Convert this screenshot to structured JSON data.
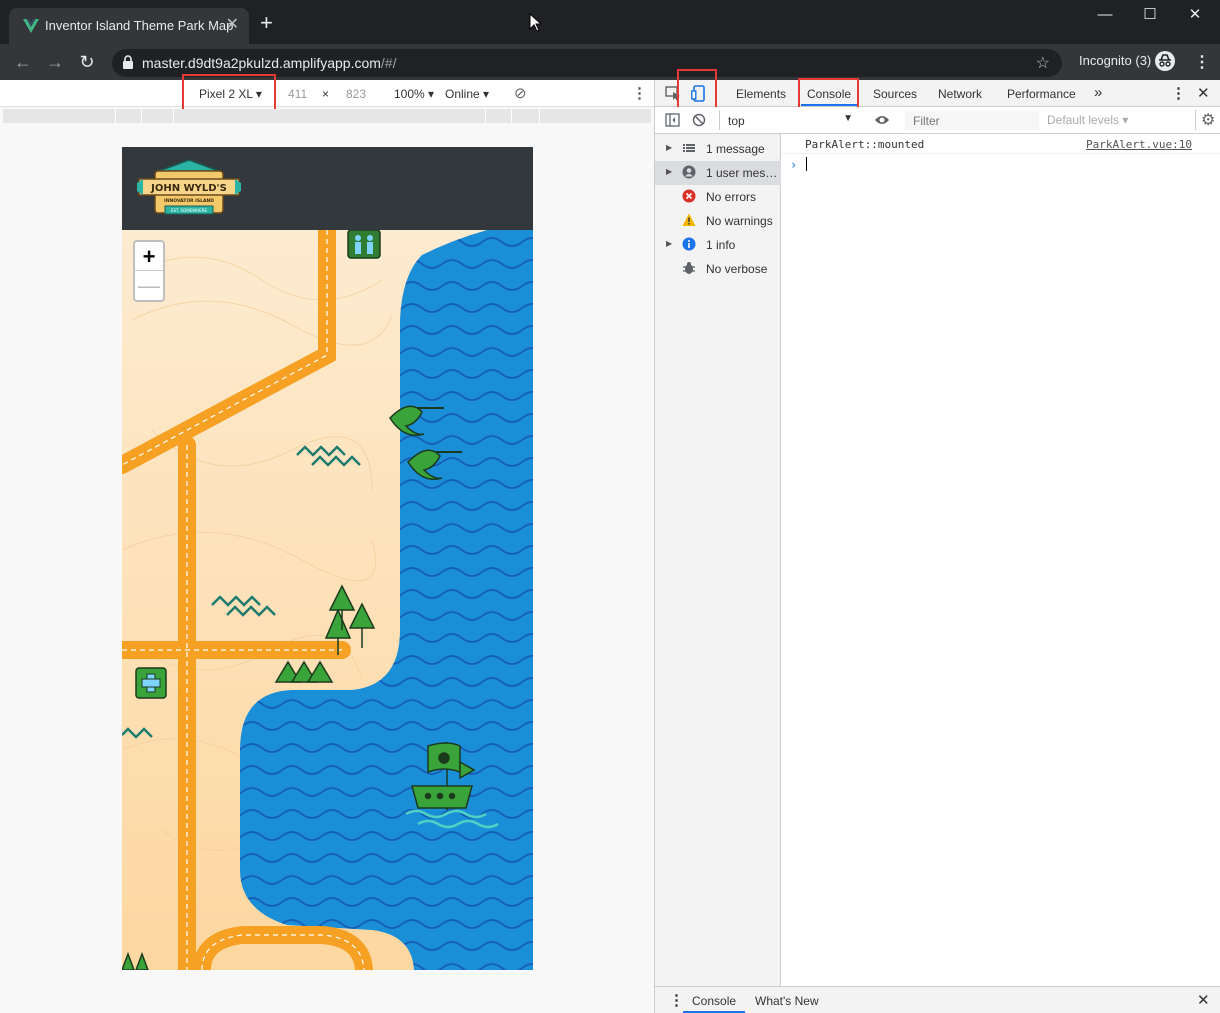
{
  "browser": {
    "tab": {
      "title": "Inventor Island Theme Park Map"
    },
    "url": {
      "host": "master.d9dt9a2pkulzd.amplifyapp.com",
      "path": "/#/"
    },
    "incognito_label": "Incognito (3)"
  },
  "device_toolbar": {
    "device": "Pixel 2 XL",
    "width": "411",
    "times": "×",
    "height": "823",
    "zoom": "100%",
    "network": "Online"
  },
  "map": {
    "zoom_in": "+",
    "zoom_out": "—",
    "logo": {
      "line1": "JOHN WYLD'S",
      "line2": "INNOVATOR ISLAND",
      "line3": "EST. SOMEWHERE"
    }
  },
  "devtools": {
    "tabs": [
      "Elements",
      "Console",
      "Sources",
      "Network",
      "Performance"
    ],
    "more_tabs": "»",
    "context": "top",
    "filter_placeholder": "Filter",
    "levels": "Default levels",
    "sidebar": [
      {
        "label": "1 message",
        "icon": "list-icon",
        "expandable": true
      },
      {
        "label": "1 user mess…",
        "icon": "user-icon",
        "expandable": true
      },
      {
        "label": "No errors",
        "icon": "error-icon",
        "expandable": false
      },
      {
        "label": "No warnings",
        "icon": "warning-icon",
        "expandable": false
      },
      {
        "label": "1 info",
        "icon": "info-icon",
        "expandable": true
      },
      {
        "label": "No verbose",
        "icon": "bug-icon",
        "expandable": false
      }
    ],
    "console": {
      "message": "ParkAlert::mounted",
      "source": "ParkAlert.vue:10",
      "prompt": "›"
    },
    "drawer_tabs": [
      "Console",
      "What's New"
    ]
  },
  "colors": {
    "accent_blue": "#1a73e8",
    "highlight_red": "#e53935",
    "water": "#1a8fd8",
    "sand": "#fde6c4",
    "path": "#f7a124"
  }
}
